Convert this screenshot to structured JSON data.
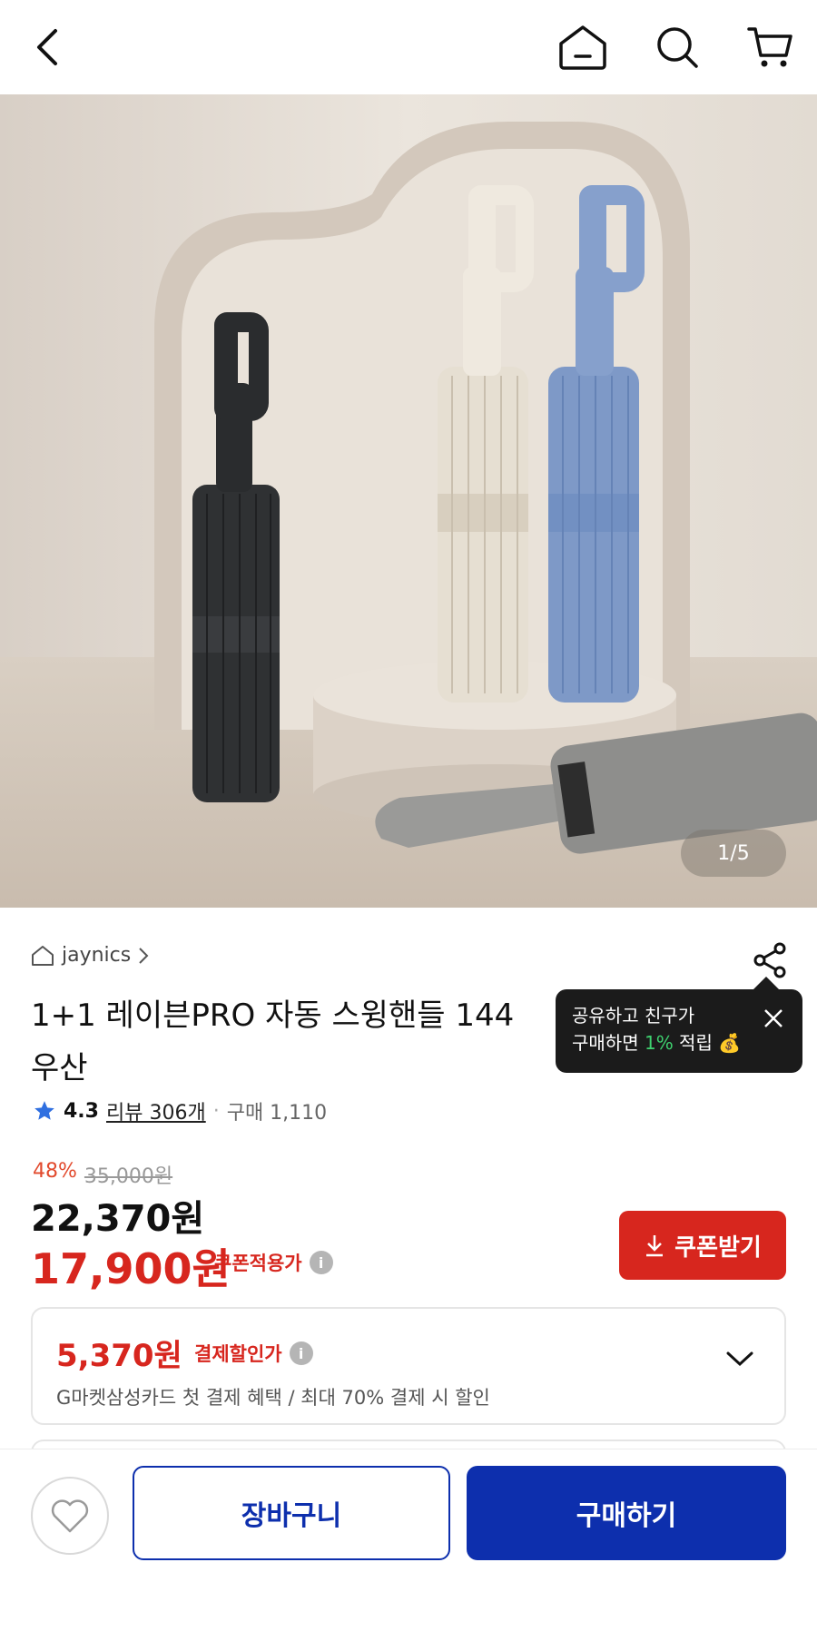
{
  "header": {
    "back_icon": "chevron-left-icon",
    "home_icon": "home-icon",
    "search_icon": "search-icon",
    "cart_icon": "cart-icon"
  },
  "hero": {
    "counter": "1/5",
    "umbrella_colors": [
      "#2f3133",
      "#e6dfd2",
      "#7e99c7",
      "#8e8e8c"
    ]
  },
  "product": {
    "seller": "jaynics",
    "title_line1": "1+1 레이븐PRO 자동 스윙핸들 144",
    "title_line2": "우산",
    "rating": "4.3",
    "review_label": "리뷰 306개",
    "purchase_label": "구매 1,110"
  },
  "tooltip": {
    "line1": "공유하고 친구가",
    "line2_prefix": "구매하면 ",
    "line2_highlight": "1%",
    "line2_suffix": " 적립 💰"
  },
  "price": {
    "discount_pct": "48%",
    "original": "35,000원",
    "sale": "22,370원",
    "coupon_price": "17,900원",
    "coupon_label": "쿠폰적용가",
    "coupon_button": "쿠폰받기"
  },
  "payment": {
    "amount": "5,370원",
    "label": "결제할인가",
    "description": "G마켓삼성카드 첫 결제 혜택 / 최대 70% 결제 시 할인"
  },
  "bottom": {
    "cart_button": "장바구니",
    "buy_button": "구매하기"
  },
  "colors": {
    "accent_red": "#d7261e",
    "primary_blue": "#0d2fad"
  }
}
